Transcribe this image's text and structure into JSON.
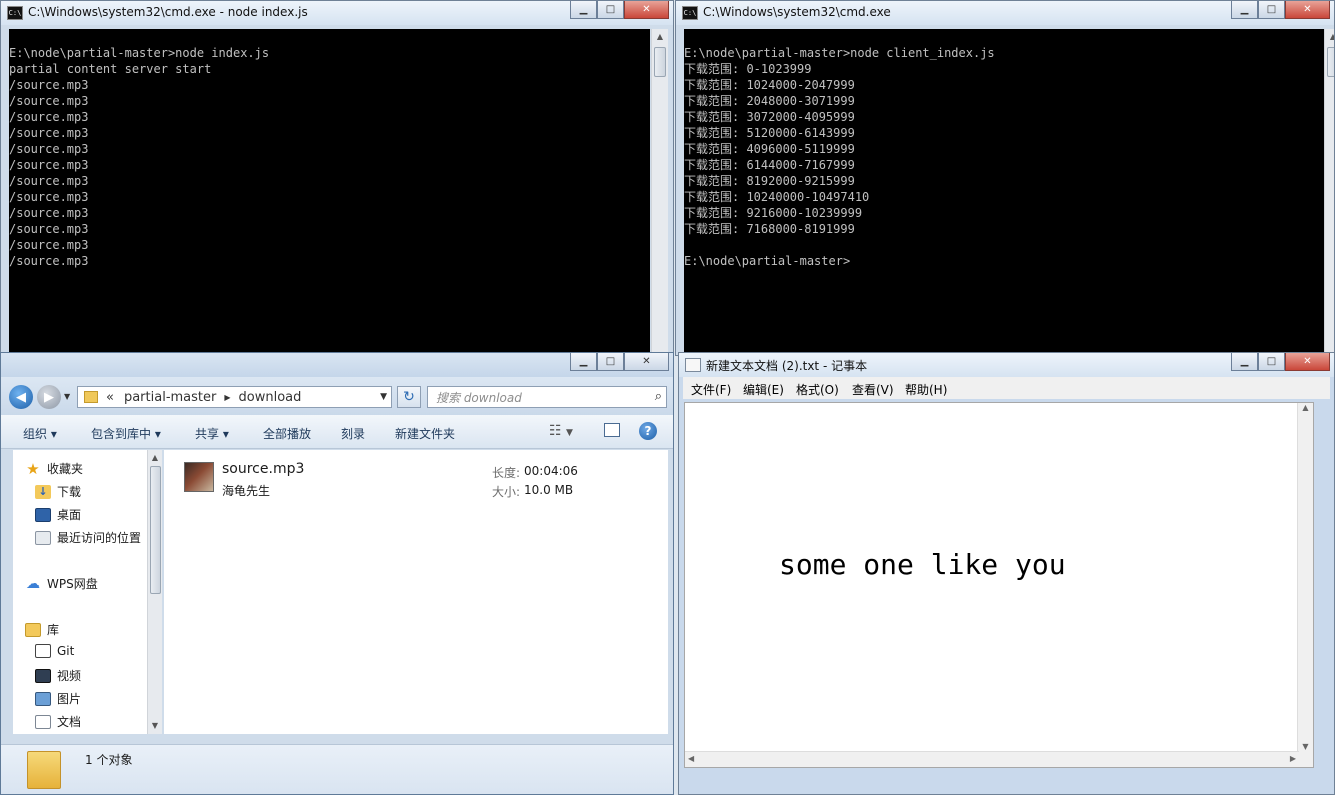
{
  "cmd_left": {
    "title": "C:\\Windows\\system32\\cmd.exe - node  index.js",
    "lines": [
      "E:\\node\\partial-master>node index.js",
      "partial content server start",
      "/source.mp3",
      "/source.mp3",
      "/source.mp3",
      "/source.mp3",
      "/source.mp3",
      "/source.mp3",
      "/source.mp3",
      "/source.mp3",
      "/source.mp3",
      "/source.mp3",
      "/source.mp3",
      "/source.mp3"
    ]
  },
  "cmd_right": {
    "title": "C:\\Windows\\system32\\cmd.exe",
    "lines": [
      "E:\\node\\partial-master>node client_index.js",
      "下载范围: 0-1023999",
      "下载范围: 1024000-2047999",
      "下载范围: 2048000-3071999",
      "下载范围: 3072000-4095999",
      "下载范围: 5120000-6143999",
      "下载范围: 4096000-5119999",
      "下载范围: 6144000-7167999",
      "下载范围: 8192000-9215999",
      "下载范围: 10240000-10497410",
      "下载范围: 9216000-10239999",
      "下载范围: 7168000-8191999",
      "",
      "E:\\node\\partial-master>"
    ]
  },
  "explorer": {
    "breadcrumb": [
      "partial-master",
      "download"
    ],
    "breadcrumb_prefix": "«",
    "search_placeholder": "搜索 download",
    "toolbar": {
      "organize": "组织",
      "include": "包含到库中",
      "share": "共享",
      "play_all": "全部播放",
      "burn": "刻录",
      "new_folder": "新建文件夹"
    },
    "nav": {
      "favorites": "收藏夹",
      "downloads": "下载",
      "desktop": "桌面",
      "recent": "最近访问的位置",
      "wps": "WPS网盘",
      "libraries": "库",
      "git": "Git",
      "videos": "视频",
      "pictures": "图片",
      "documents": "文档"
    },
    "file": {
      "name": "source.mp3",
      "artist": "海龟先生",
      "length_label": "长度:",
      "length_value": "00:04:06",
      "size_label": "大小:",
      "size_value": "10.0 MB"
    },
    "status": "1 个对象"
  },
  "notepad": {
    "title": "新建文本文档 (2).txt - 记事本",
    "menus": [
      "文件(F)",
      "编辑(E)",
      "格式(O)",
      "查看(V)",
      "帮助(H)"
    ],
    "content": "some one like you"
  },
  "window_controls": {
    "minimize": "▁",
    "maximize": "□",
    "close": "✕"
  }
}
